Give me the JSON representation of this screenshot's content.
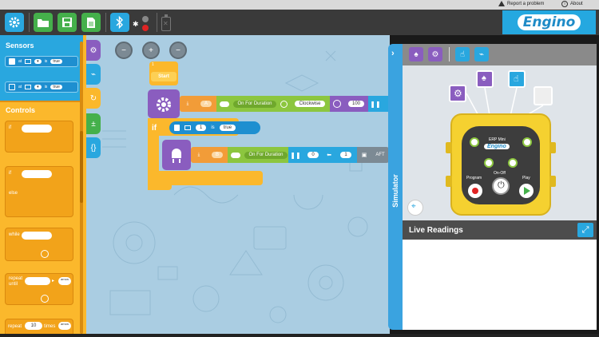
{
  "header": {
    "report_label": "Report a problem",
    "about_label": "About",
    "logo_text": "Engino",
    "report_icon": "warning-triangle-icon",
    "about_icon": "info-icon"
  },
  "toolbar": {
    "buttons": [
      {
        "name": "settings-gear-icon"
      },
      {
        "name": "open-folder-icon"
      },
      {
        "name": "save-disk-icon"
      },
      {
        "name": "new-file-icon"
      },
      {
        "name": "bluetooth-icon"
      },
      {
        "name": "connection-status-icon"
      },
      {
        "name": "battery-icon"
      }
    ]
  },
  "palette": {
    "sensors_title": "Sensors",
    "controls_title": "Controls",
    "sensor_blocks": [
      {
        "port_label": "at",
        "compare": "is",
        "value": "true"
      },
      {
        "port_label": "at",
        "compare": "is",
        "value": "true"
      }
    ],
    "control_blocks": [
      {
        "label": "if"
      },
      {
        "label": "if",
        "else_label": "else"
      },
      {
        "label": "while"
      },
      {
        "label": "repeat until",
        "dropdown": "arrow"
      },
      {
        "label": "repeat",
        "count": "10",
        "times_label": "times",
        "dropdown": "arrow"
      }
    ]
  },
  "workspace": {
    "start_label": "Start",
    "start_number": "1",
    "motor_block_1": {
      "port": "A",
      "mode": "On For Duration",
      "direction": "Clockwise",
      "speed": "100"
    },
    "if_label": "if",
    "if_sensor": {
      "port": "1",
      "compare": "is",
      "value": "true"
    },
    "motor_block_2": {
      "port": "B",
      "mode": "On For Duration",
      "value_a": "0",
      "value_b": "1",
      "tail": "AFT"
    }
  },
  "simulator": {
    "handle_label": "Simulator",
    "live_readings_label": "Live Readings",
    "device_brand": "Engino",
    "device_model": "ERP Mini",
    "program_label": "Program",
    "onoff_label": "On-Off",
    "play_label": "Play"
  },
  "colors": {
    "sensor_blue": "#29a7df",
    "control_orange": "#fbb82c",
    "motor_green": "#8cc63f",
    "motion_purple": "#8a5dbf",
    "logo_blue": "#25a8e0"
  }
}
